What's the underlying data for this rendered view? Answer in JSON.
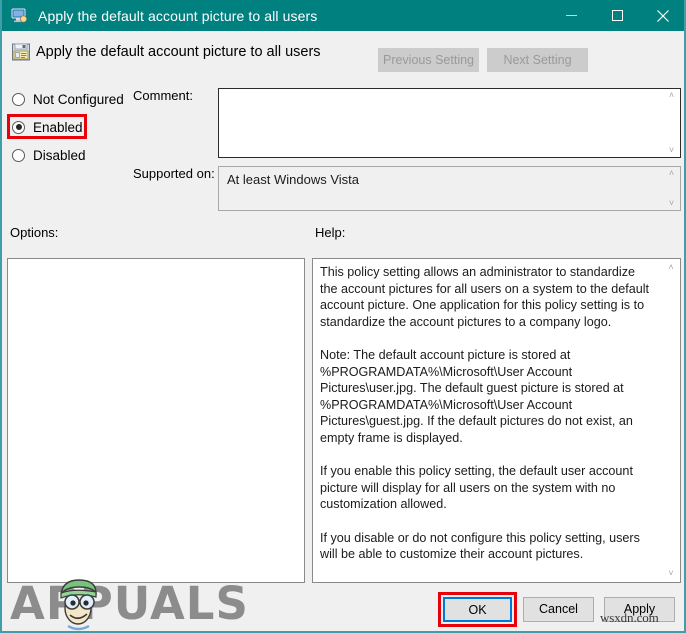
{
  "window": {
    "title": "Apply the default account picture to all users",
    "title_icon": "monitor-policy-icon",
    "minimize_label": "—",
    "maximize_label": "□",
    "close_label": "✕",
    "accent_color": "#00807f",
    "border_color": "#3f9ea8"
  },
  "header": {
    "policy_icon": "group-policy-setting-icon",
    "policy_title": "Apply the default account picture to all users",
    "previous_setting_label": "Previous Setting",
    "next_setting_label": "Next Setting",
    "nav_buttons_disabled": true
  },
  "state_group": {
    "options": [
      {
        "id": "not-configured",
        "label": "Not Configured",
        "selected": false
      },
      {
        "id": "enabled",
        "label": "Enabled",
        "selected": true
      },
      {
        "id": "disabled",
        "label": "Disabled",
        "selected": false
      }
    ],
    "highlight_color": "#e8000b",
    "highlighted_option": "Enabled"
  },
  "comment": {
    "label": "Comment:",
    "value": "",
    "placeholder": ""
  },
  "supported_on": {
    "label": "Supported on:",
    "value": "At least Windows Vista"
  },
  "panels": {
    "options_label": "Options:",
    "options_content": "",
    "help_label": "Help:",
    "help_text": "This policy setting allows an administrator to standardize the account pictures for all users on a system to the default account picture. One application for this policy setting is to standardize the account pictures to a company logo.\n\nNote: The default account picture is stored at %PROGRAMDATA%\\Microsoft\\User Account Pictures\\user.jpg. The default guest picture is stored at %PROGRAMDATA%\\Microsoft\\User Account Pictures\\guest.jpg. If the default pictures do not exist, an empty frame is displayed.\n\nIf you enable this policy setting, the default user account picture will display for all users on the system with no customization allowed.\n\nIf you disable or do not configure this policy setting, users will be able to customize their account pictures."
  },
  "scrollbar": {
    "up_arrow": "˄",
    "down_arrow": "˅"
  },
  "footer": {
    "ok_label": "OK",
    "cancel_label": "Cancel",
    "apply_label": "Apply",
    "ok_focused": true,
    "ok_highlight_color": "#e8000b",
    "ok_focus_color": "#0078d7"
  },
  "watermarks": {
    "brand_text": "APPUALS",
    "site_text": "wsxdn.com"
  }
}
